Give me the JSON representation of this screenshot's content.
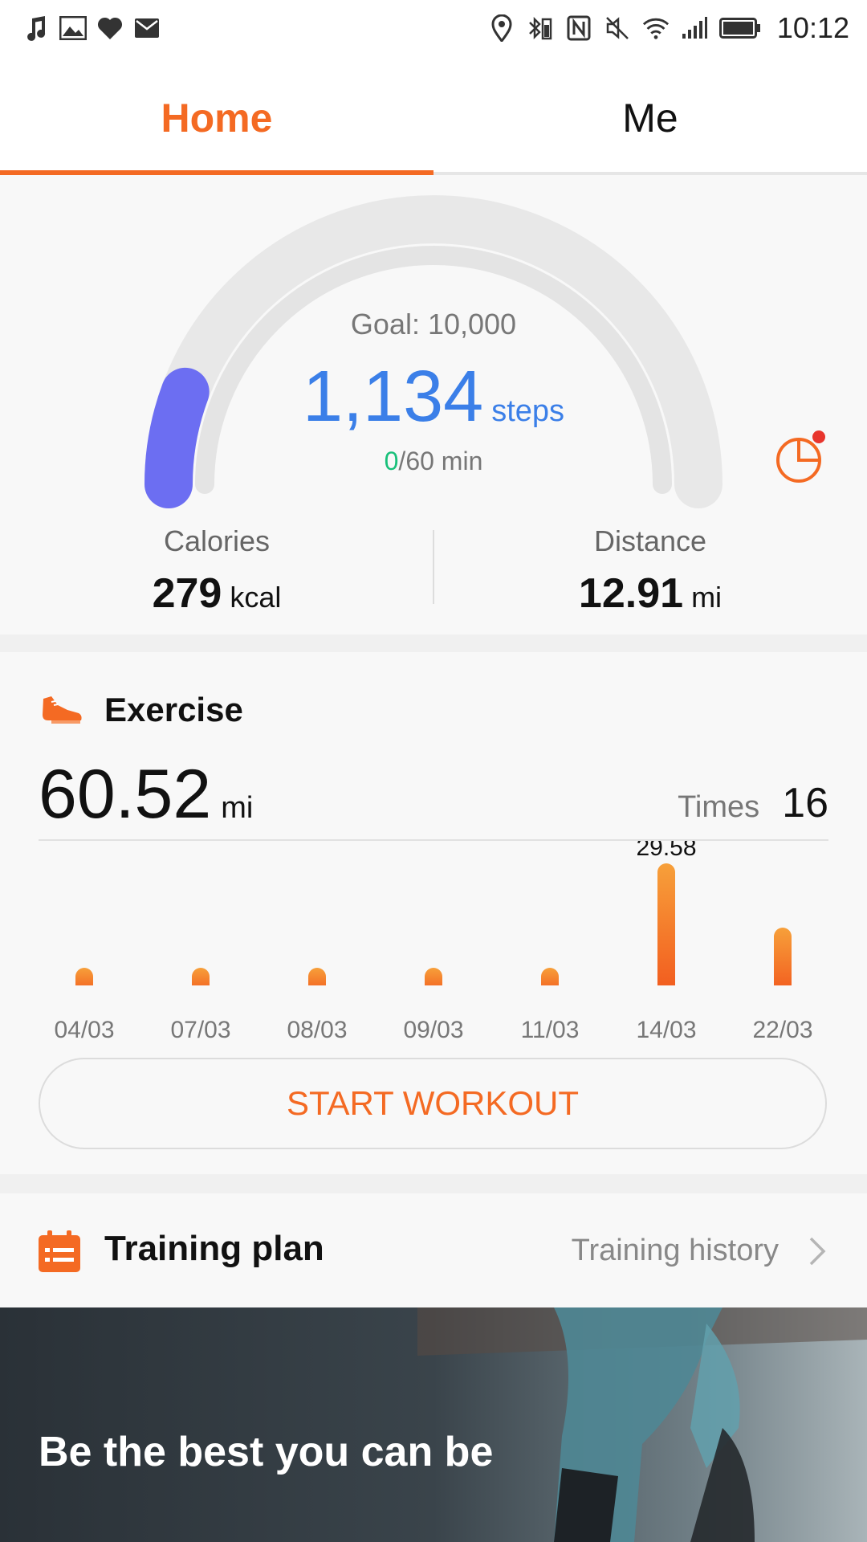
{
  "status_bar": {
    "left_icons": [
      "music-note-icon",
      "gallery-icon",
      "heart-icon",
      "mail-icon"
    ],
    "right_icons": [
      "location-icon",
      "bluetooth-icon",
      "nfc-icon",
      "mute-icon",
      "wifi-icon",
      "signal-icon",
      "battery-icon"
    ],
    "time": "10:12"
  },
  "tabs": [
    {
      "label": "Home",
      "active": true
    },
    {
      "label": "Me",
      "active": false
    }
  ],
  "summary": {
    "goal_text": "Goal: 10,000",
    "steps": "1,134",
    "steps_unit": "steps",
    "minutes_done": "0",
    "minutes_rest": "/60 min",
    "progress_fraction": 0.1134,
    "calories_label": "Calories",
    "calories_value": "279",
    "calories_unit": "kcal",
    "distance_label": "Distance",
    "distance_value": "12.91",
    "distance_unit": "mi"
  },
  "exercise": {
    "title": "Exercise",
    "total": "60.52",
    "total_unit": "mi",
    "times_label": "Times",
    "times_value": "16",
    "start_label": "START WORKOUT"
  },
  "chart_data": {
    "type": "bar",
    "categories": [
      "04/03",
      "07/03",
      "08/03",
      "09/03",
      "11/03",
      "14/03",
      "22/03"
    ],
    "values": [
      1.2,
      1.0,
      1.8,
      0.9,
      2.2,
      29.58,
      14.0
    ],
    "annotations": [
      {
        "category": "14/03",
        "label": "29.58"
      }
    ],
    "ylim": [
      0,
      29.58
    ],
    "grid": false
  },
  "training": {
    "title": "Training plan",
    "history_label": "Training history"
  },
  "banner": {
    "text": "Be the best you can be"
  },
  "colors": {
    "accent": "#f46a23",
    "steps_blue": "#3b7fe8",
    "gauge_fill": "#6c6ef2",
    "green": "#18c07a"
  }
}
